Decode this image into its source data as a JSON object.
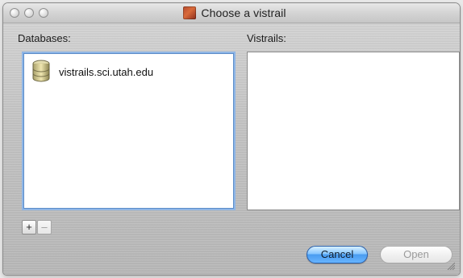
{
  "window": {
    "title": "Choose a vistrail"
  },
  "databases": {
    "label": "Databases:",
    "items": [
      {
        "label": "vistrails.sci.utah.edu"
      }
    ]
  },
  "vistrails": {
    "label": "Vistrails:",
    "items": []
  },
  "controls": {
    "add_label": "+",
    "remove_label": "–",
    "cancel_label": "Cancel",
    "open_label": "Open"
  },
  "colors": {
    "focus_ring": "#8fb6e6",
    "default_button": "#4a9cf0",
    "disabled_text": "#9a9a9a"
  },
  "icons": {
    "database": "database-icon",
    "app": "vistrails-app-icon"
  }
}
